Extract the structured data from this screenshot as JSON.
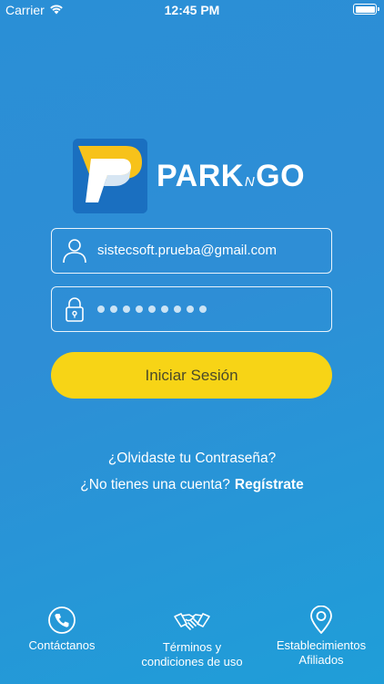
{
  "status_bar": {
    "carrier": "Carrier",
    "time": "12:45 PM",
    "battery_level": 1.0
  },
  "logo": {
    "brand_main": "PARK",
    "brand_mid": "N",
    "brand_end": "GO"
  },
  "login": {
    "email_value": "sistecsoft.prueba@gmail.com",
    "password_mask_count": 9,
    "submit_label": "Iniciar Sesión"
  },
  "links": {
    "forgot_password": "¿Olvidaste tu Contraseña?",
    "no_account": "¿No tienes una cuenta?",
    "register": "Regístrate"
  },
  "footer": {
    "contact": {
      "label": "Contáctanos",
      "icon": "phone-icon"
    },
    "terms": {
      "label_line1": "Términos y",
      "label_line2": "condiciones de uso",
      "icon": "handshake-icon"
    },
    "establishments": {
      "label_line1": "Establecimientos",
      "label_line2": "Afiliados",
      "icon": "location-pin-icon"
    }
  },
  "colors": {
    "background": "#2e8ed6",
    "accent_button": "#f7d416"
  }
}
